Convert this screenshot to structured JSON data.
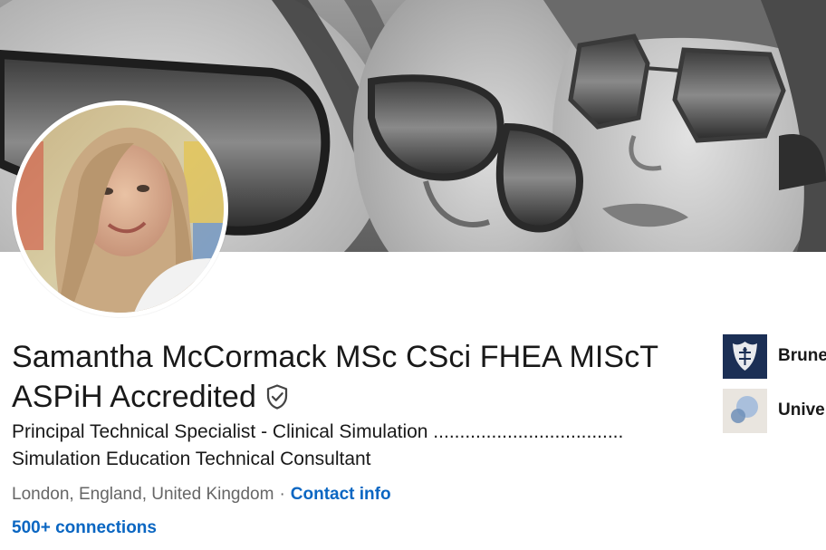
{
  "profile": {
    "name": "Samantha McCormack MSc CSci FHEA MIScT ASPiH Accredited",
    "headline": "Principal Technical Specialist - Clinical Simulation .................................... Simulation Education Technical Consultant",
    "location": "London, England, United Kingdom",
    "separator": "·",
    "contact_info": "Contact info",
    "connections": "500+ connections",
    "verified_icon": "verified-shield-icon"
  },
  "side_panel": {
    "items": [
      {
        "label": "Brunel University London",
        "logo": "brunel-crest-logo",
        "color": "#1b2f55"
      },
      {
        "label": "University",
        "logo": "university-circles-logo",
        "color": "#e9e5df"
      }
    ]
  },
  "colors": {
    "link": "#0a66c2",
    "text_primary": "#191919",
    "text_secondary": "#666666"
  }
}
